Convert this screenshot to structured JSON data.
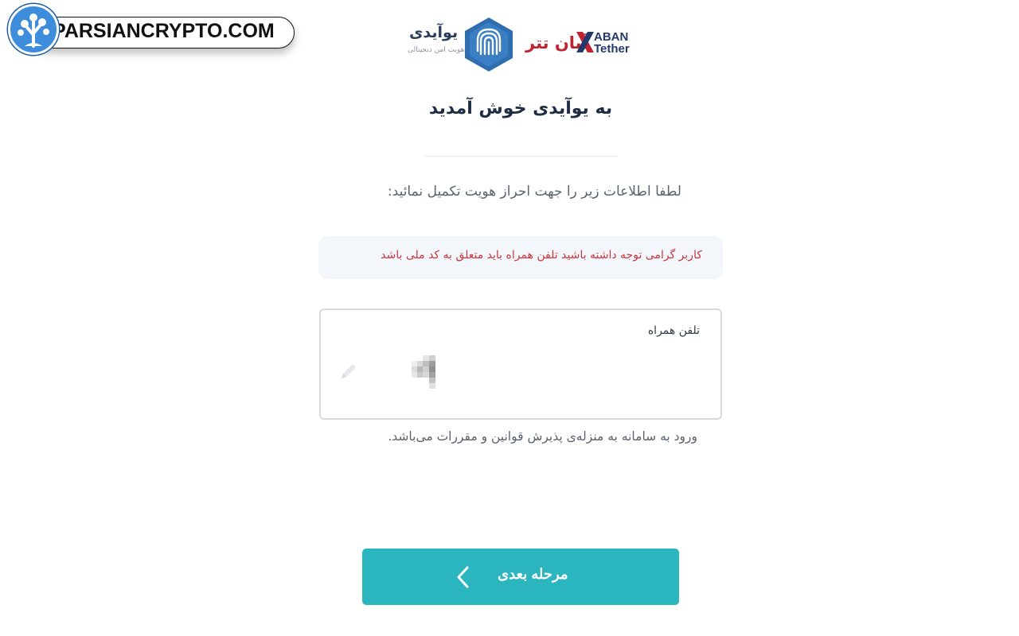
{
  "watermark": {
    "text": "PARSIANCRYPTO.COM",
    "icon": "tree-logo-icon"
  },
  "header": {
    "uid_brand": "یوآیدی",
    "uid_tagline": "هویت امن دیجیتالی",
    "uid_icon": "fingerprint-icon",
    "aban_fa": "آبان تتر",
    "aban_en_line1": "ABAN",
    "aban_en_line2": "Tether",
    "aban_icon": "x-logo-icon"
  },
  "main": {
    "title": "به یوآیدی خوش آمدید",
    "instruction": "لطفا اطلاعات زیر را جهت احراز هویت تکمیل نمائید:",
    "alert": "کاربر گرامی توجه داشته باشید تلفن همراه باید متعلق به کد ملی باشد",
    "phone_label": "تلفن همراه",
    "phone_value": "",
    "terms": "ورود به سامانه به منزله‌ی پذیرش قوانین و مقررات می‌باشد.",
    "next_button": "مرحله بعدی"
  },
  "colors": {
    "accent": "#2bb5bf",
    "alert_text": "#c9363c",
    "alert_bg": "#f3f7fc",
    "aban_red": "#c0242f",
    "aban_blue": "#253a6c",
    "uid_blue": "#2f6fb0"
  }
}
